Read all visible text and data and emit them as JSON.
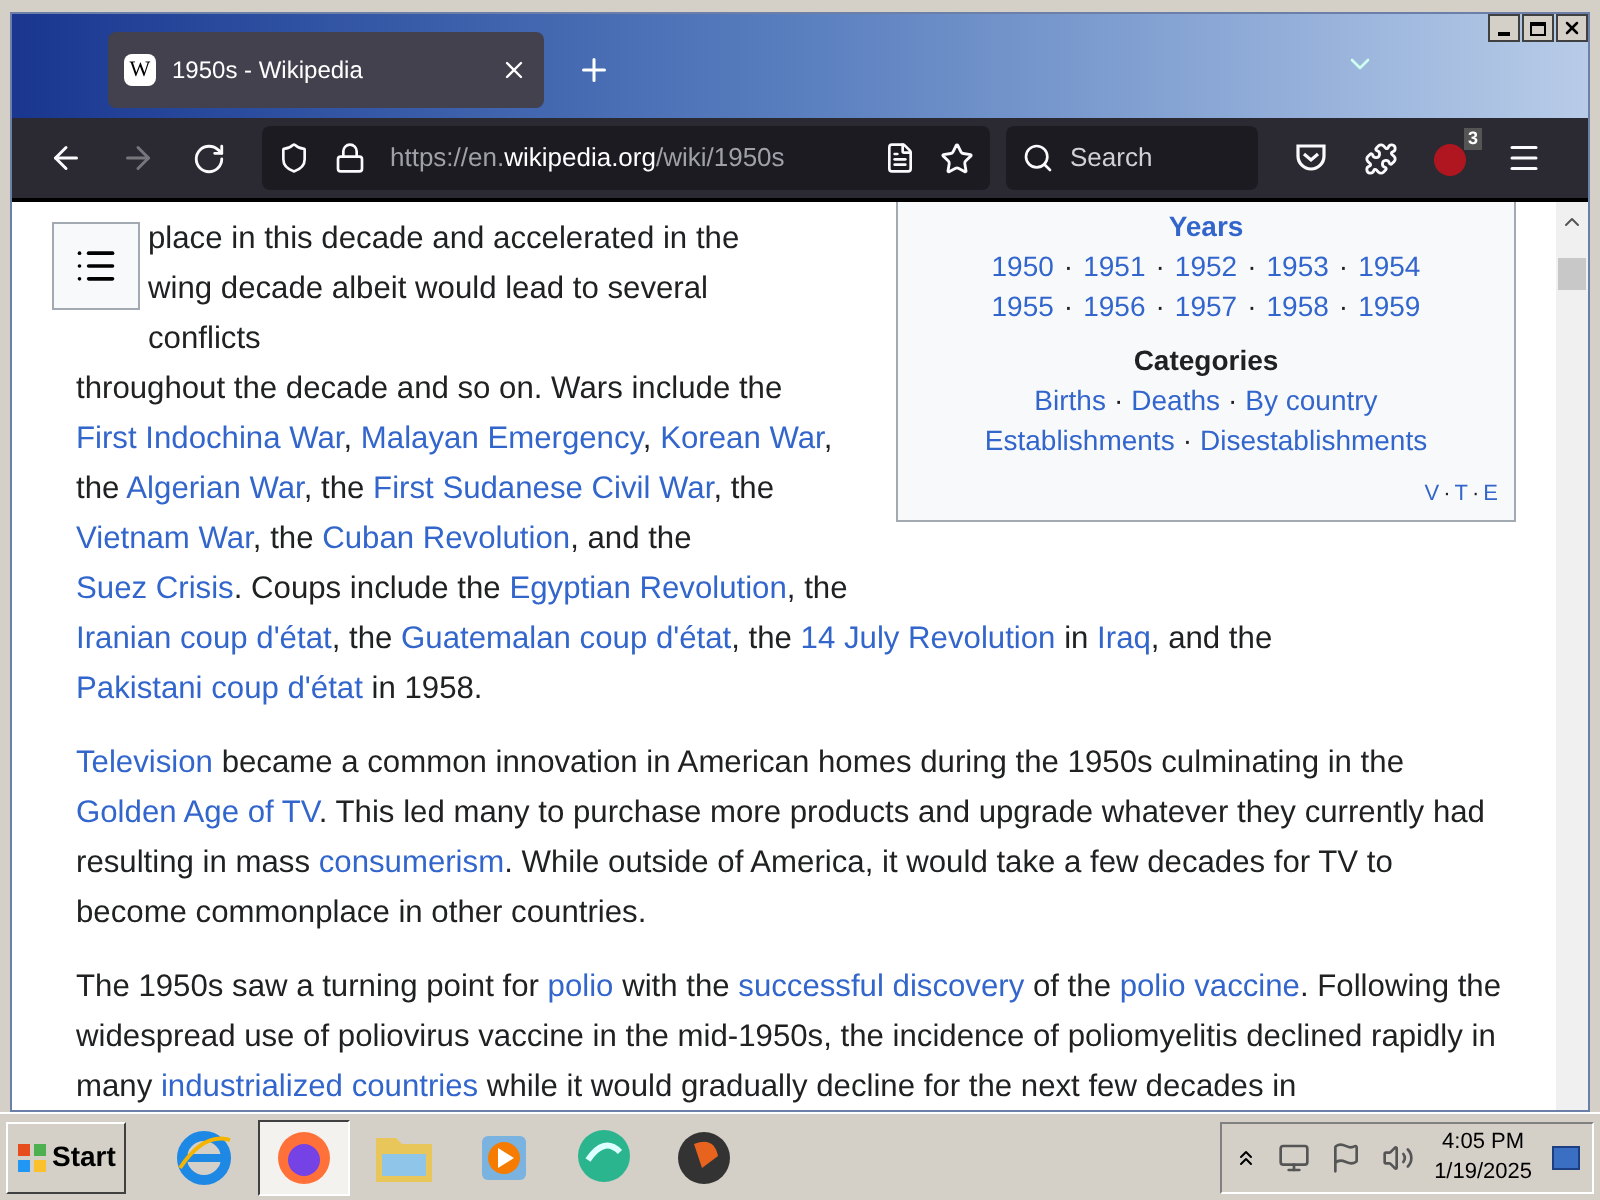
{
  "tab": {
    "title": "1950s - Wikipedia",
    "icon_letter": "W",
    "selected": true
  },
  "address": {
    "prefix": "https://en.",
    "domain": "wikipedia.org",
    "path": "/wiki/1950s"
  },
  "search": {
    "placeholder": "Search"
  },
  "extension_badge": "3",
  "navbox": {
    "years_title": "Years",
    "separator": "·",
    "year_rows": [
      [
        "1950",
        "1951",
        "1952",
        "1953",
        "1954"
      ],
      [
        "1955",
        "1956",
        "1957",
        "1958",
        "1959"
      ]
    ],
    "categories_title": "Categories",
    "category_rows": [
      [
        "Births",
        "Deaths",
        "By country"
      ],
      [
        "Establishments",
        "Disestablishments"
      ]
    ],
    "vte": [
      "V",
      "T",
      "E"
    ]
  },
  "text_blocks": [
    [
      {
        "t": "place in this decade and accelerated in the wing decade albeit would lead to several conflicts"
      }
    ],
    [
      {
        "t": "throughout the decade and so on. Wars include the "
      },
      {
        "t": "First Indochina War",
        "link": true
      },
      {
        "t": ", "
      },
      {
        "t": "Malayan Emergency",
        "link": true
      },
      {
        "t": ", "
      },
      {
        "t": "Korean War",
        "link": true
      },
      {
        "t": ", the "
      },
      {
        "t": "Algerian War",
        "link": true
      },
      {
        "t": ", the "
      },
      {
        "t": "First Sudanese Civil War",
        "link": true
      },
      {
        "t": ", the "
      },
      {
        "t": "Vietnam War",
        "link": true
      },
      {
        "t": ", the "
      },
      {
        "t": "Cuban Revolution",
        "link": true
      },
      {
        "t": ", and the "
      },
      {
        "t": "Suez Crisis",
        "link": true
      },
      {
        "t": ". Coups include the "
      },
      {
        "t": "Egyptian Revolution",
        "link": true
      },
      {
        "t": ", the"
      }
    ],
    [
      {
        "t": "Iranian coup d'état",
        "link": true
      },
      {
        "t": ", the "
      },
      {
        "t": "Guatemalan coup d'état",
        "link": true
      },
      {
        "t": ", the "
      },
      {
        "t": "14 July Revolution",
        "link": true
      },
      {
        "t": " in "
      },
      {
        "t": "Iraq",
        "link": true
      },
      {
        "t": ", and the "
      },
      {
        "t": "Pakistani coup d'état",
        "link": true
      },
      {
        "t": " in 1958."
      }
    ],
    [
      {
        "t": "Television",
        "link": true
      },
      {
        "t": " became a common innovation in American homes during the 1950s culminating in the "
      },
      {
        "t": "Golden Age of TV",
        "link": true
      },
      {
        "t": ". This led many to purchase more products and upgrade whatever they currently had resulting in mass "
      },
      {
        "t": "consumerism",
        "link": true
      },
      {
        "t": ". While outside of America, it would take a few decades for TV to become commonplace in other countries."
      }
    ],
    [
      {
        "t": "The 1950s saw a turning point for "
      },
      {
        "t": "polio",
        "link": true
      },
      {
        "t": " with the "
      },
      {
        "t": "successful discovery",
        "link": true
      },
      {
        "t": " of the "
      },
      {
        "t": "polio vaccine",
        "link": true
      },
      {
        "t": ". Following the widespread use of poliovirus vaccine in the mid-1950s, the incidence of poliomyelitis declined rapidly in many "
      },
      {
        "t": "industrialized countries",
        "link": true
      },
      {
        "t": " while it would gradually decline for the next few decades in"
      }
    ]
  ],
  "taskbar": {
    "start": "Start",
    "apps": [
      {
        "kind": "ie",
        "selected": false
      },
      {
        "kind": "firefox",
        "selected": true
      },
      {
        "kind": "folder",
        "selected": false
      },
      {
        "kind": "media",
        "selected": false
      },
      {
        "kind": "chat",
        "selected": false
      },
      {
        "kind": "bird",
        "selected": false
      }
    ],
    "time": "4:05 PM",
    "date": "1/19/2025"
  }
}
